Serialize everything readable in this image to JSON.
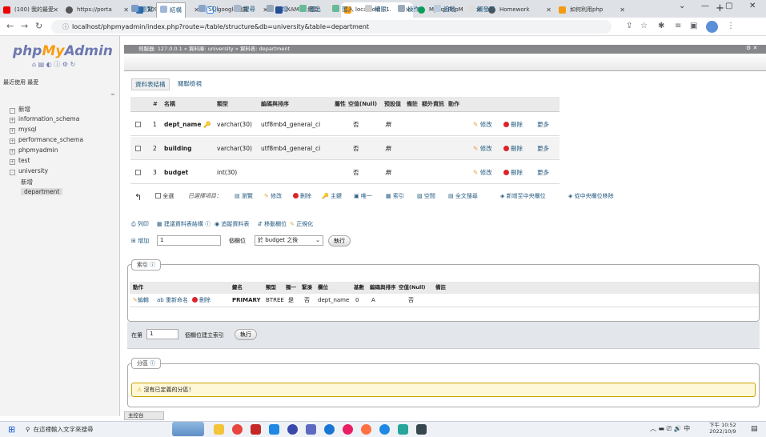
{
  "browser": {
    "tabs": [
      {
        "label": "(100) 我的最愛",
        "color": "#e00"
      },
      {
        "label": "https://porta",
        "color": "#555"
      },
      {
        "label": "1093306.HW",
        "color": "#2b6cb0"
      },
      {
        "label": "google翻譯",
        "color": "#4285f4"
      },
      {
        "label": "XAMPP 網頁",
        "color": "#264a9e"
      },
      {
        "label": "localhost / 1.",
        "color": "#f89c0e"
      },
      {
        "label": "MySql-PhpM",
        "color": "#0a9d58"
      },
      {
        "label": "Homework",
        "color": "#555"
      },
      {
        "label": "如何利用php",
        "color": "#f39c12"
      }
    ],
    "url": "localhost/phpmyadmin/index.php?route=/table/structure&db=university&table=department"
  },
  "pma": {
    "logo_php": "php",
    "logo_my": "My",
    "logo_admin": "Admin",
    "recent": "最近使用",
    "favorites": "最愛",
    "tree": [
      "新增",
      "information_schema",
      "mysql",
      "performance_schema",
      "phpmyadmin",
      "test",
      "university",
      "新增",
      "department"
    ],
    "breadcrumb": "伺服器: 127.0.0.1 » 資料庫: university » 資料表: department",
    "menu": [
      "瀏覽",
      "結構",
      "SQL",
      "搜尋",
      "新增",
      "匯出",
      "匯入",
      "權限",
      "操作",
      "追蹤",
      "觸發器"
    ],
    "subtabs": [
      "資料表結構",
      "關聯檢視"
    ],
    "columns": [
      "#",
      "名稱",
      "類型",
      "編碼與排序",
      "屬性",
      "空值(Null)",
      "預設值",
      "備註",
      "額外資訊",
      "動作"
    ],
    "rows": [
      {
        "num": "1",
        "name": "dept_name",
        "type": "varchar(30)",
        "collation": "utf8mb4_general_ci",
        "null": "否",
        "default": "無"
      },
      {
        "num": "2",
        "name": "building",
        "type": "varchar(30)",
        "collation": "utf8mb4_general_ci",
        "null": "否",
        "default": "無"
      },
      {
        "num": "3",
        "name": "budget",
        "type": "int(30)",
        "collation": "",
        "null": "否",
        "default": "無"
      }
    ],
    "row_actions": [
      "修改",
      "刪除",
      "更多"
    ],
    "bulk": [
      "全選",
      "已選擇項目：",
      "瀏覽",
      "修改",
      "刪除",
      "主鍵",
      "唯一",
      "索引",
      "空間",
      "全文搜尋",
      "新增至中央欄位",
      "從中央欄位移除"
    ],
    "tools": [
      "列印",
      "建議資料表結構",
      "追蹤資料表",
      "移動欄位",
      "正規化"
    ],
    "add_label": "增加",
    "add_count": "1",
    "add_unit": "個欄位",
    "add_after": "於 budget 之後",
    "go": "執行",
    "index_legend": "索引",
    "index_headers": [
      "動作",
      "鍵名",
      "類型",
      "獨一",
      "緊湊",
      "欄位",
      "基數",
      "編碼與排序",
      "空值(Null)",
      "備註"
    ],
    "index_actions": [
      "編輯",
      "重新命名",
      "刪除"
    ],
    "index_row": {
      "key": "PRIMARY",
      "type": "BTREE",
      "unique": "是",
      "packed": "否",
      "column": "dept_name",
      "cardinality": "0",
      "collation": "A",
      "null": "否"
    },
    "create_index_prefix": "在第",
    "create_index_count": "1",
    "create_index_suffix": "個欄位建立索引",
    "partition_legend": "分區",
    "partition_msg": "沒有已定義的分區！",
    "console": "主控台"
  },
  "taskbar": {
    "search": "在這裡輸入文字來搜尋",
    "time": "下午 10:52",
    "date": "2022/10/9",
    "lang": "中"
  }
}
